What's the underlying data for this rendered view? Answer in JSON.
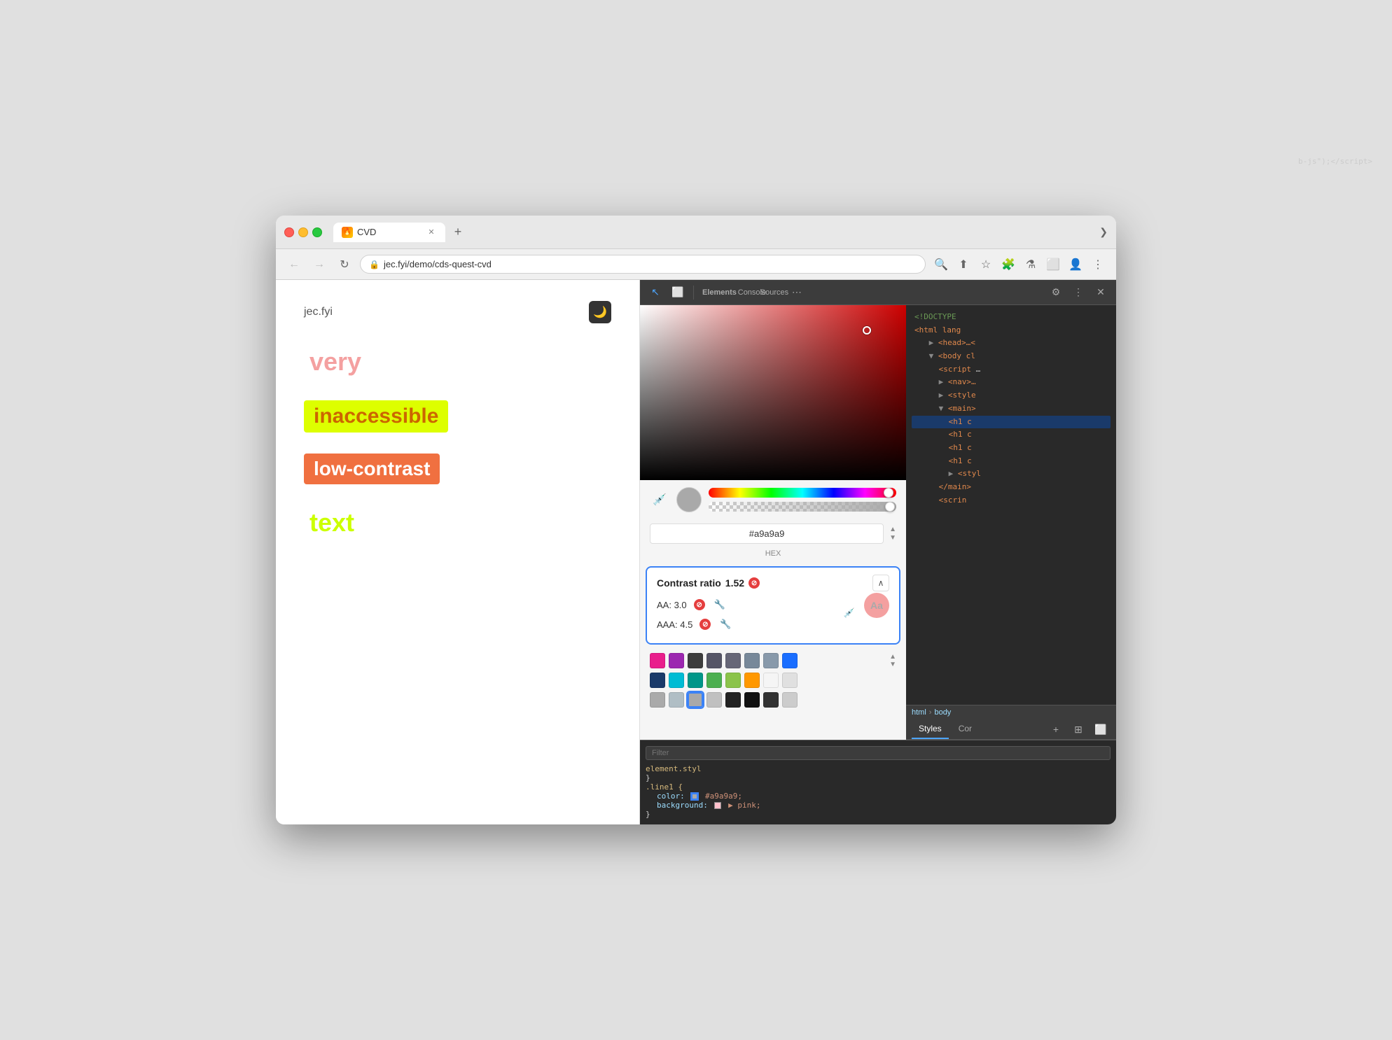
{
  "browser": {
    "tab_title": "CVD",
    "url": "jec.fyi/demo/cds-quest-cvd",
    "new_tab_label": "+",
    "chevron_label": "❯"
  },
  "webpage": {
    "site_title": "jec.fyi",
    "dark_mode_icon": "🌙",
    "demo_items": [
      {
        "text": "very",
        "style": "very"
      },
      {
        "text": "inaccessible",
        "style": "inaccessible"
      },
      {
        "text": "low-contrast",
        "style": "lowcontrast"
      },
      {
        "text": "text",
        "style": "text"
      }
    ]
  },
  "devtools": {
    "toolbar": {
      "inspect_icon": "↖",
      "device_icon": "⬜",
      "more_icon": "⋯",
      "gear_icon": "⚙",
      "more_vert_icon": "⋮",
      "close_icon": "✕"
    },
    "html": {
      "doctype": "<!DOCTYPE",
      "html_tag": "<html lang",
      "head_tag": "▶ <head>…<",
      "body_tag": "▼ <body cl",
      "script_tag": "<script",
      "script_end": "b-js\");</script",
      "nav_tag": "▶ <nav>…",
      "style_tag": "▶ <style",
      "main_tag": "▼ <main>",
      "h1_tags": [
        "<h1 c",
        "<h1 c",
        "<h1 c",
        "<h1 c"
      ],
      "styl_tag": "▶ <styl",
      "main_close": "</main>",
      "script_bottom": "<scrin"
    },
    "tabs": {
      "styles_label": "Styles",
      "computed_label": "Cor",
      "html_label": "html",
      "body_label": "body"
    },
    "color_picker": {
      "hex_value": "#a9a9a9",
      "format_label": "HEX"
    },
    "contrast": {
      "title": "Contrast ratio",
      "ratio": "1.52",
      "fail_icon": "⊘",
      "aa_label": "AA: 3.0",
      "aaa_label": "AAA: 4.5",
      "preview_text": "Aa"
    },
    "styles": {
      "filter_placeholder": "Filter",
      "element_style": "element.styl",
      "brace_open": "{",
      "brace_close": "}",
      "line1_selector": ".line1 {",
      "color_prop": "color:",
      "color_value": "",
      "background_prop": "background:",
      "background_value": "▶  pink;",
      "brace_close2": "}"
    },
    "swatches": {
      "row1": [
        "#e91e8c",
        "#9c27b0",
        "#3d3d3d",
        "#555566",
        "#666677",
        "#778899",
        "#8899aa",
        "#1a6eff"
      ],
      "row2": [
        "#1a3a6a",
        "#00bcd4",
        "#009688",
        "#4caf50",
        "#8bc34a",
        "#ff9800",
        "#f5f5f5",
        "#e0e0e0"
      ],
      "row3": [
        "#aaaaaa",
        "#b0bec5",
        "#c0c0c0",
        "#222222",
        "#111111",
        "#333333",
        "#cccccc",
        "#dddddd"
      ]
    }
  }
}
